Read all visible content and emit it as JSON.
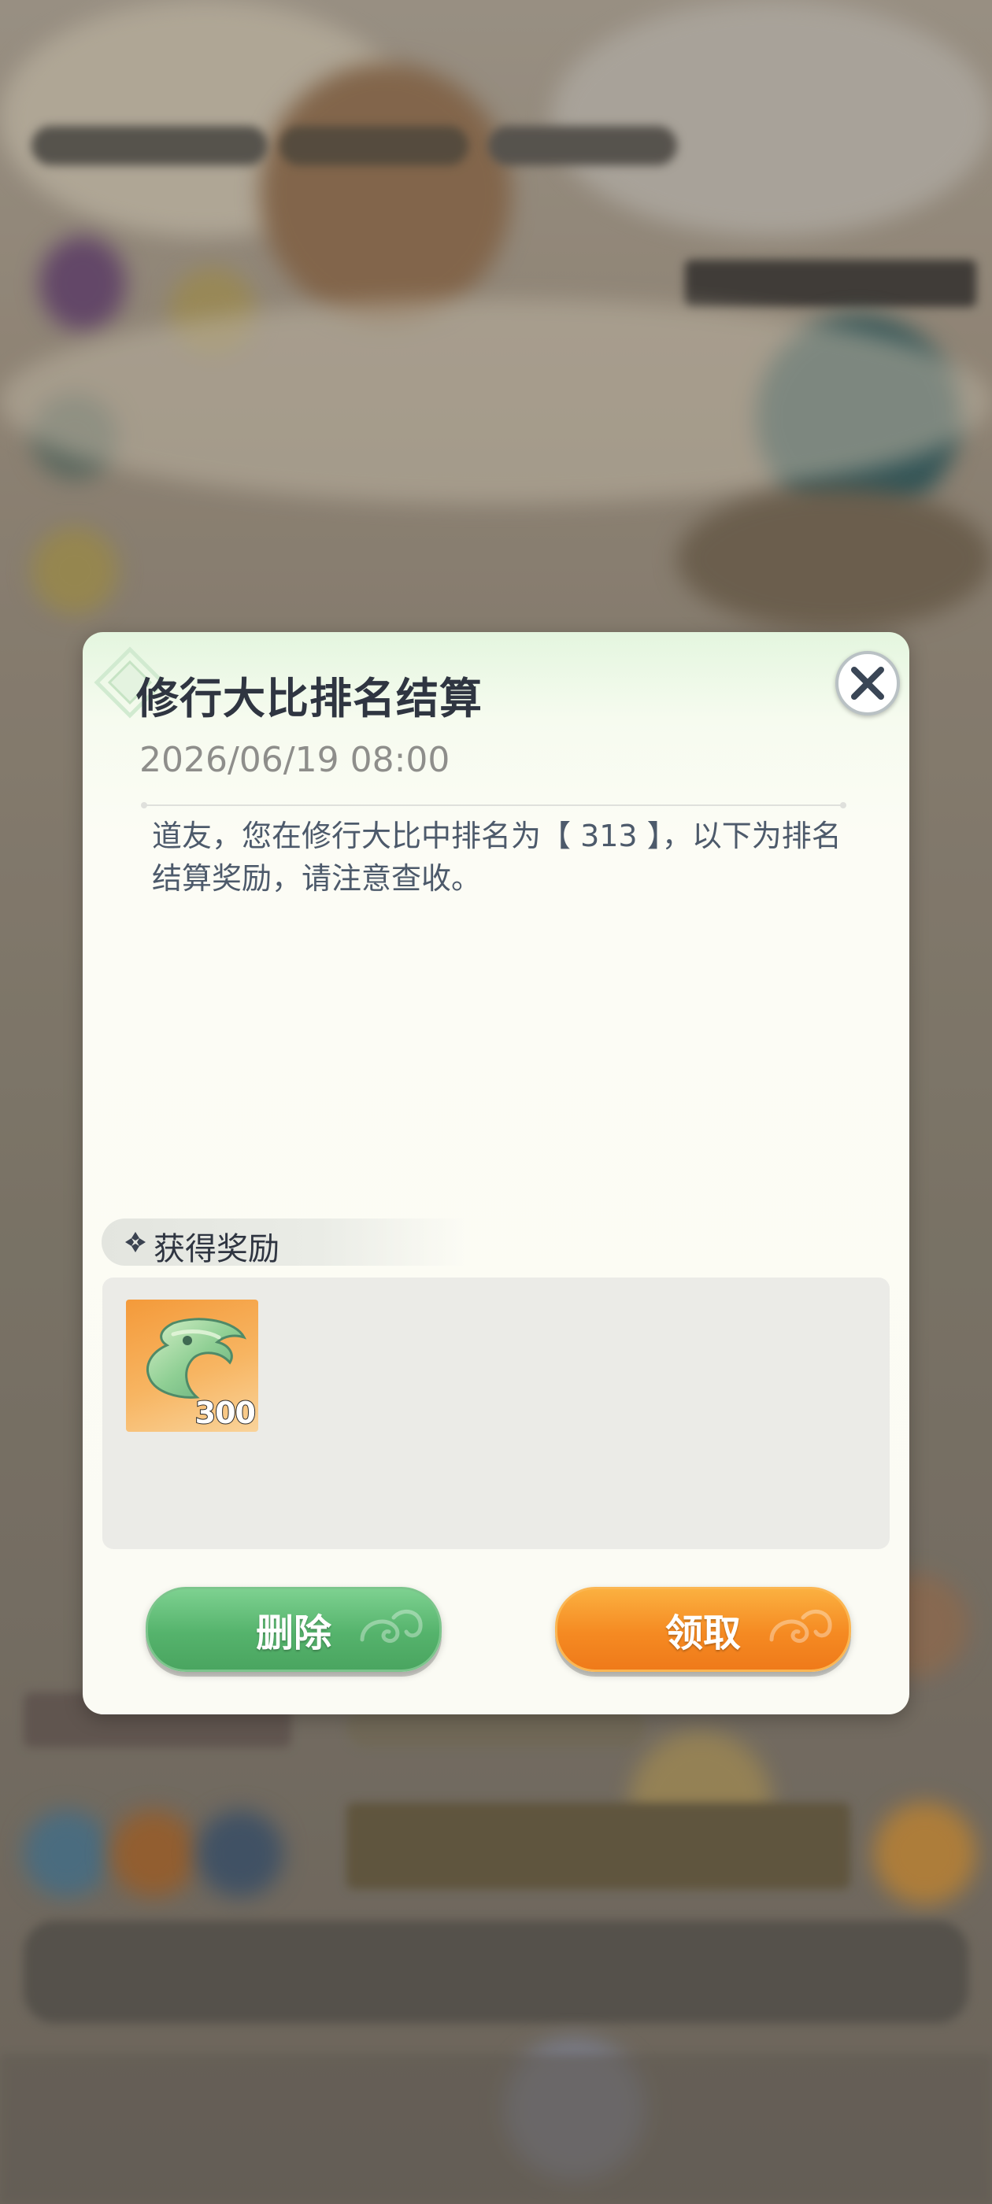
{
  "dialog": {
    "title": "修行大比排名结算",
    "datetime": "2026/06/19 08:00",
    "message": "道友，您在修行大比中排名为【 313 】，以下为排名结算奖励，请注意查收。",
    "rewards_header": "获得奖励",
    "rewards": [
      {
        "icon": "jade-claw-icon",
        "count": "300"
      }
    ],
    "buttons": {
      "delete_label": "删除",
      "claim_label": "领取"
    }
  },
  "colors": {
    "title": "#2f3541",
    "message": "#4d5a6b",
    "delete_button": "#55b36c",
    "claim_button": "#f58a22",
    "reward_bg": "#f49a3a"
  }
}
